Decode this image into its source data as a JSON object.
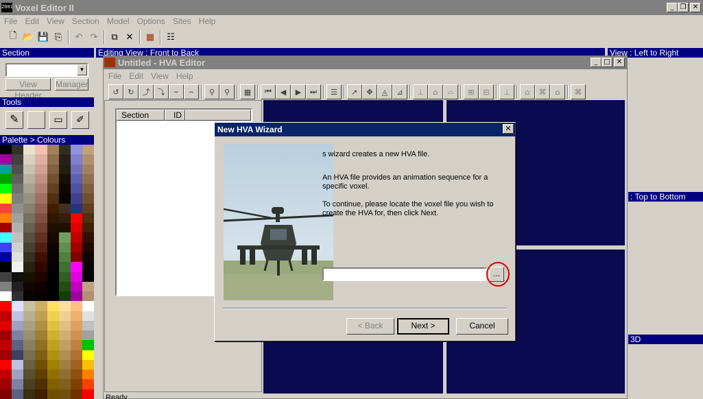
{
  "outer_window": {
    "title": "Voxel Editor II",
    "logo_text": "2001",
    "menu": [
      "File",
      "Edit",
      "View",
      "Section",
      "Model",
      "Options",
      "Sites",
      "Help"
    ],
    "controls": {
      "minimize": "_",
      "restore": "❐",
      "close": "✕"
    }
  },
  "left_panel": {
    "section_header": "Section",
    "view_header_btn": "View Header",
    "manager_btn": "Manager",
    "tools_header": "Tools",
    "palette_header": "Palette > Colours"
  },
  "views": {
    "editing_view": "Editing View : Front to Back",
    "view_left_right": "View : Left to Right",
    "view_top_bottom": ": Top to Bottom",
    "view_3d": "3D"
  },
  "hva_editor": {
    "title": "Untitled - HVA Editor",
    "menu": [
      "File",
      "Edit",
      "View",
      "Help"
    ],
    "list_columns": [
      "Section",
      "ID"
    ],
    "status": "Ready"
  },
  "dialog": {
    "title": "New HVA Wizard",
    "para1": "s wizard creates a new HVA file.",
    "para2": "An HVA file provides an animation sequence for a specific voxel.",
    "para3": "To continue, please locate the voxel file you wish to create the HVA for, then click Next.",
    "file_input_value": "",
    "browse_label": "...",
    "back_label": "< Back",
    "next_label": "Next >",
    "cancel_label": "Cancel",
    "close_label": "✕"
  },
  "colors": {
    "navy_panel": "#0a0a50",
    "active_title": "#0a246a",
    "inactive_title": "#808080",
    "highlight_circle": "#d40000"
  }
}
